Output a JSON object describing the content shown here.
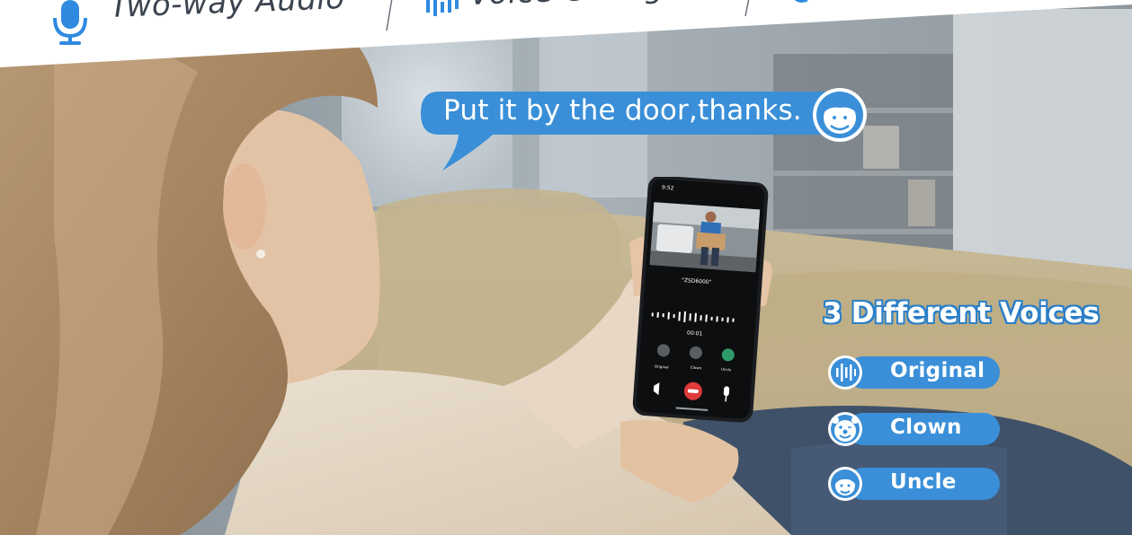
{
  "banner": {
    "item1_label": "Two-way Audio",
    "item2_label": "Voice Chang"
  },
  "speech": {
    "text": "Put it by the door,thanks."
  },
  "phone_screen": {
    "status_time": "9:52",
    "caption": "\"ZSD6000\"",
    "call_timer": "00:01",
    "voice_options": [
      "Original",
      "Clown",
      "Uncle"
    ]
  },
  "voices": {
    "title": "3 Different Voices",
    "items": [
      {
        "label": "Original",
        "icon": "waveform-icon"
      },
      {
        "label": "Clown",
        "icon": "clown-face-icon"
      },
      {
        "label": "Uncle",
        "icon": "uncle-face-icon"
      }
    ]
  },
  "colors": {
    "accent_blue": "#3a8fd8",
    "title_outline": "#2b7fc7",
    "banner_text": "#3b4450",
    "hangup_red": "#e0393b"
  }
}
